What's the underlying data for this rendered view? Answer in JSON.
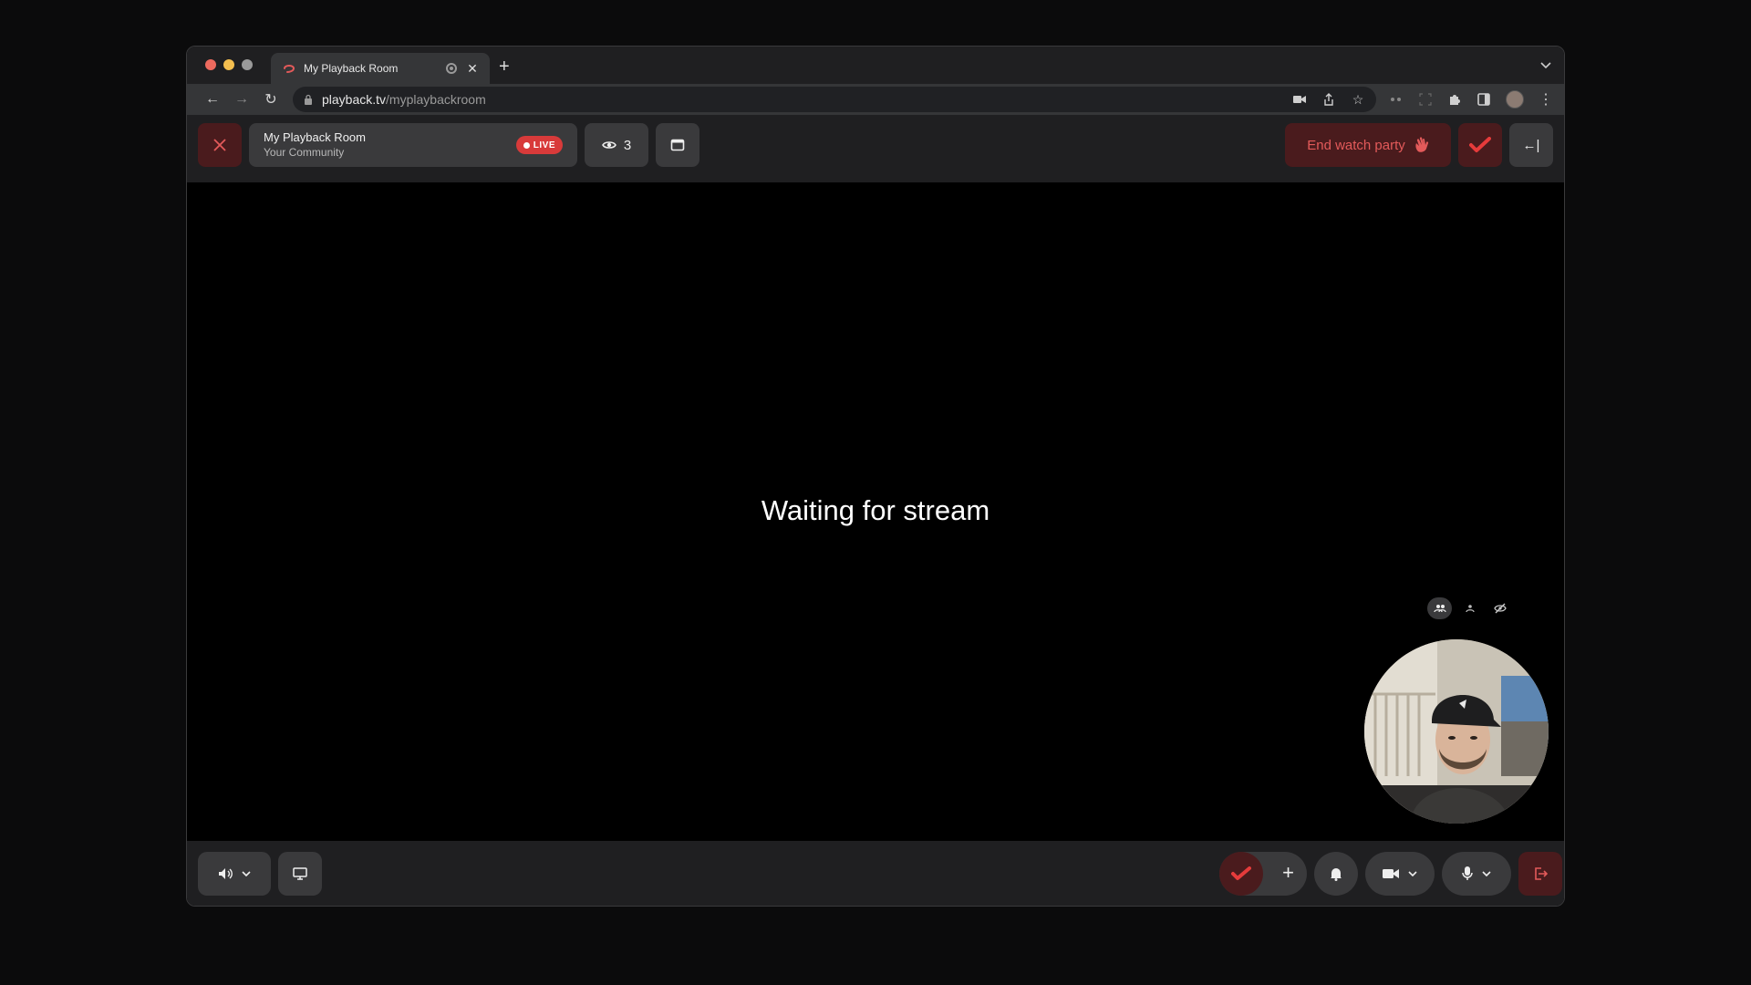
{
  "browser": {
    "tab_title": "My Playback Room",
    "tab_close": "✕",
    "new_tab": "+",
    "url_host": "playback.tv",
    "url_path": "/myplaybackroom"
  },
  "room": {
    "name": "My Playback Room",
    "community": "Your Community",
    "live_label": "LIVE",
    "viewer_count": "3"
  },
  "header": {
    "end_party_label": "End watch party",
    "collapse_label": "←|"
  },
  "stage": {
    "status_text": "Waiting for stream"
  },
  "colors": {
    "accent_red": "#e35a5a",
    "live_red": "#d83a3a",
    "danger_bg": "#4a1b1d"
  }
}
